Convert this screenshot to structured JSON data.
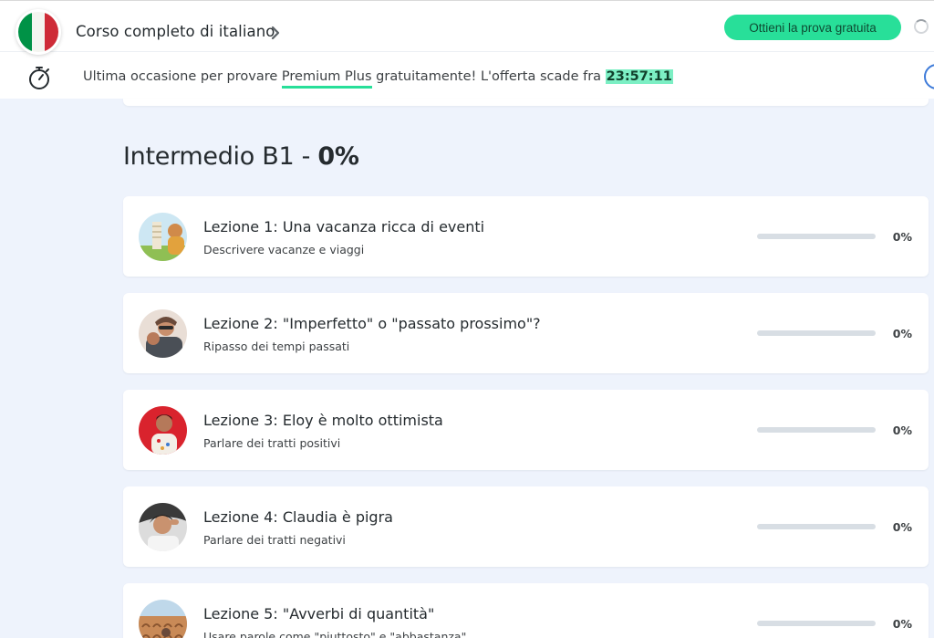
{
  "header": {
    "course_title": "Corso completo di italiano",
    "trial_button": "Ottieni la prova gratuita"
  },
  "promo": {
    "text_before": "Ultima occasione per provare ",
    "link": "Premium Plus",
    "text_after": " gratuitamente! L'offerta scade fra ",
    "timer": "23:57:11"
  },
  "section": {
    "title": "Intermedio B1 - ",
    "progress": "0%"
  },
  "lessons": [
    {
      "title": "Lezione 1: Una vacanza ricca di eventi",
      "subtitle": "Descrivere vacanze e viaggi",
      "progress_label": "0%",
      "progress": 0
    },
    {
      "title": "Lezione 2: \"Imperfetto\" o \"passato prossimo\"?",
      "subtitle": "Ripasso dei tempi passati",
      "progress_label": "0%",
      "progress": 0
    },
    {
      "title": "Lezione 3: Eloy è molto ottimista",
      "subtitle": "Parlare dei tratti positivi",
      "progress_label": "0%",
      "progress": 0
    },
    {
      "title": "Lezione 4: Claudia è pigra",
      "subtitle": "Parlare dei tratti negativi",
      "progress_label": "0%",
      "progress": 0
    },
    {
      "title": "Lezione 5: \"Avverbi di quantità\"",
      "subtitle": "Usare parole come \"piuttosto\" e \"abbastanza\"",
      "progress_label": "0%",
      "progress": 0
    }
  ],
  "colors": {
    "accent": "#28df99",
    "background": "#eef3fc",
    "timer_highlight": "#7cefc4"
  },
  "icons": [
    "italy-flag-icon",
    "chevron-right-icon",
    "stopwatch-icon",
    "loading-spinner-icon"
  ]
}
